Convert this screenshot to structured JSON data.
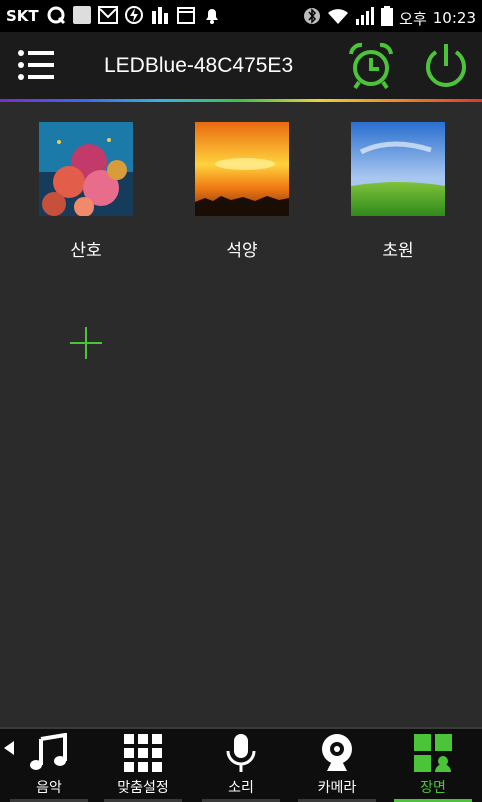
{
  "status": {
    "carrier": "SKT",
    "ampm": "오후",
    "time": "10:23"
  },
  "header": {
    "title": "LEDBlue-48C475E3"
  },
  "colors": {
    "accent": "#4cc43a",
    "background": "#2b2b2b",
    "header": "#1b1b1b"
  },
  "scenes": [
    {
      "label": "산호",
      "icon": "coral-reef-image"
    },
    {
      "label": "석양",
      "icon": "sunset-image"
    },
    {
      "label": "초원",
      "icon": "meadow-image"
    }
  ],
  "tabs": [
    {
      "label": "음악",
      "icon": "music-note-icon"
    },
    {
      "label": "맞춤설정",
      "icon": "grid-icon"
    },
    {
      "label": "소리",
      "icon": "microphone-icon"
    },
    {
      "label": "카메라",
      "icon": "webcam-icon"
    },
    {
      "label": "장면",
      "icon": "scene-icon",
      "active": true
    }
  ]
}
